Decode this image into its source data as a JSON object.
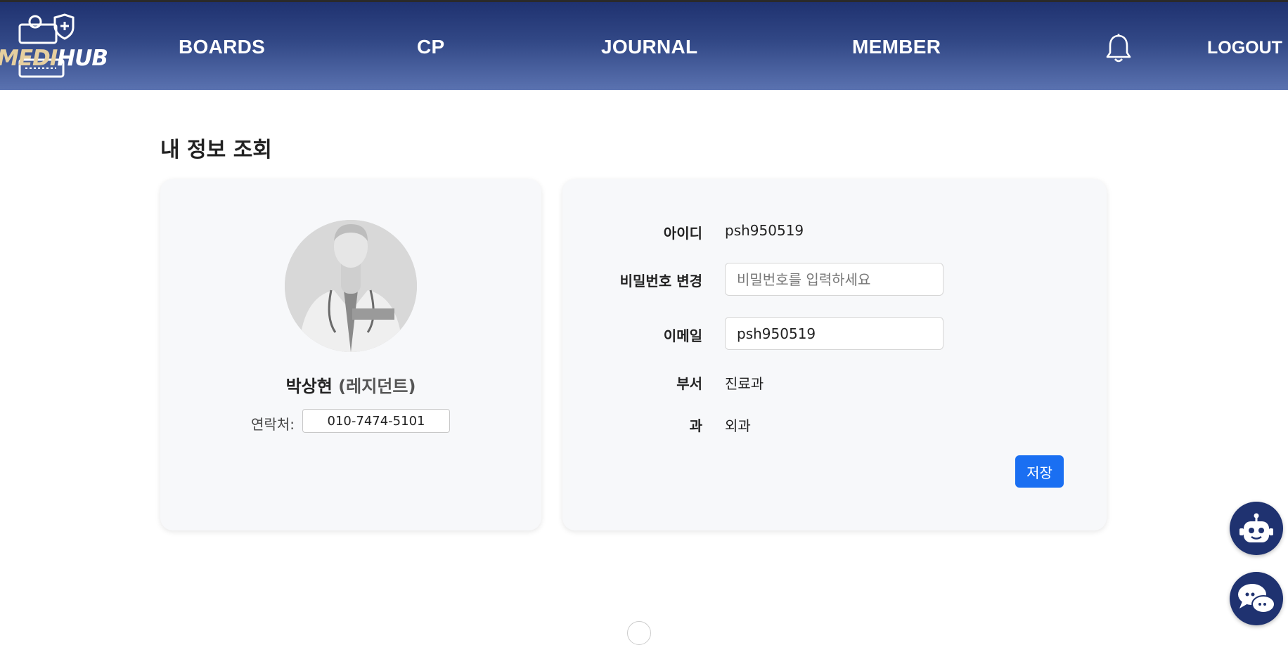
{
  "header": {
    "logo": {
      "part1": "MEDI",
      "part2": "HUB"
    },
    "nav": [
      "BOARDS",
      "CP",
      "JOURNAL",
      "MEMBER"
    ],
    "logout": "LOGOUT"
  },
  "page": {
    "title": "내 정보 조회"
  },
  "profile": {
    "name": "박상현",
    "role": "(레지던트)",
    "contact_label": "연락처:",
    "contact_value": "010-7474-5101"
  },
  "form": {
    "id_label": "아이디",
    "id_value": "psh950519",
    "password_label": "비밀번호 변경",
    "password_placeholder": "비밀번호를 입력하세요",
    "email_label": "이메일",
    "email_value": "psh950519",
    "department_label": "부서",
    "department_value": "진료과",
    "section_label": "과",
    "section_value": "외과",
    "save_label": "저장"
  },
  "colors": {
    "header_top": "#1f3270",
    "header_bottom": "#5a72b0",
    "logo_accent": "#e6cf9f",
    "primary_button": "#1a6ff2",
    "fab": "#1f3270"
  }
}
